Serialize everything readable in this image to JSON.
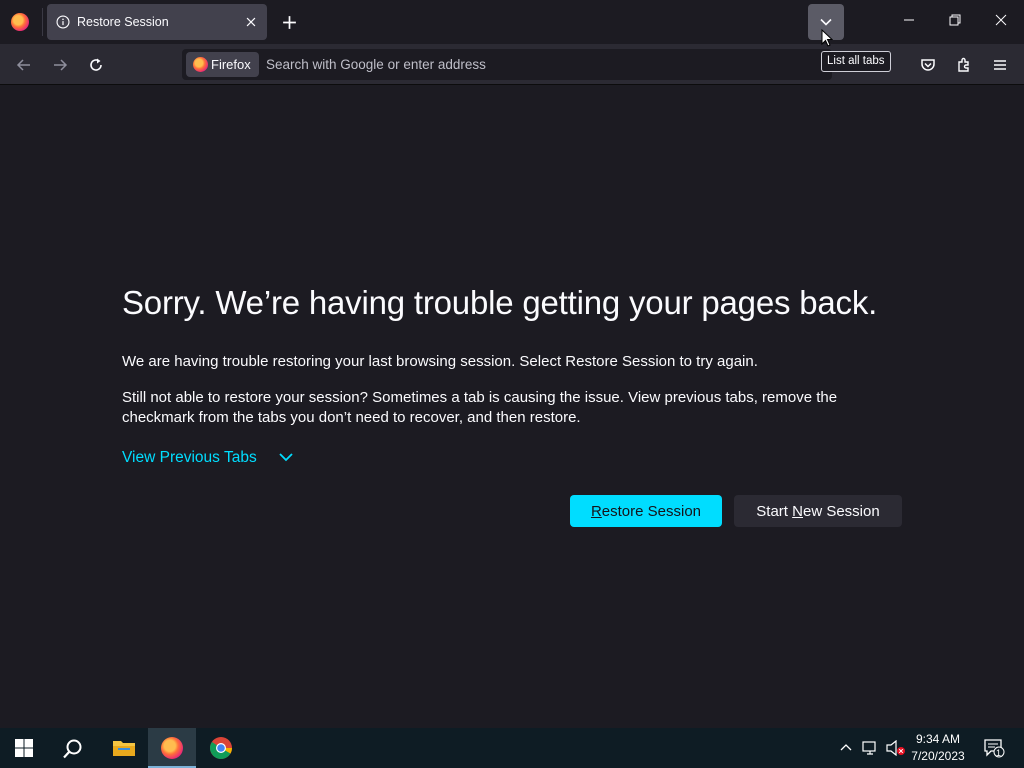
{
  "tab": {
    "title": "Restore Session"
  },
  "list_tabs_tooltip": "List all tabs",
  "urlbar": {
    "identity_label": "Firefox",
    "placeholder": "Search with Google or enter address"
  },
  "page": {
    "heading": "Sorry. We’re having trouble getting your pages back.",
    "para1": "We are having trouble restoring your last browsing session. Select Restore Session to try again.",
    "para2": "Still not able to restore your session? Sometimes a tab is causing the issue. View previous tabs, remove the checkmark from the tabs you don’t need to recover, and then restore.",
    "view_previous_tabs": "View Previous Tabs",
    "restore_button": {
      "accesskey": "R",
      "rest": "estore Session"
    },
    "new_session_button": {
      "before": "Start ",
      "accesskey": "N",
      "after": "ew Session"
    }
  },
  "taskbar": {
    "time": "9:34 AM",
    "date": "7/20/2023",
    "notifications": "1"
  },
  "colors": {
    "accent": "#00ddff",
    "background": "#1c1b22",
    "toolbar": "#2b2a33",
    "taskbar": "#0e1c24"
  }
}
